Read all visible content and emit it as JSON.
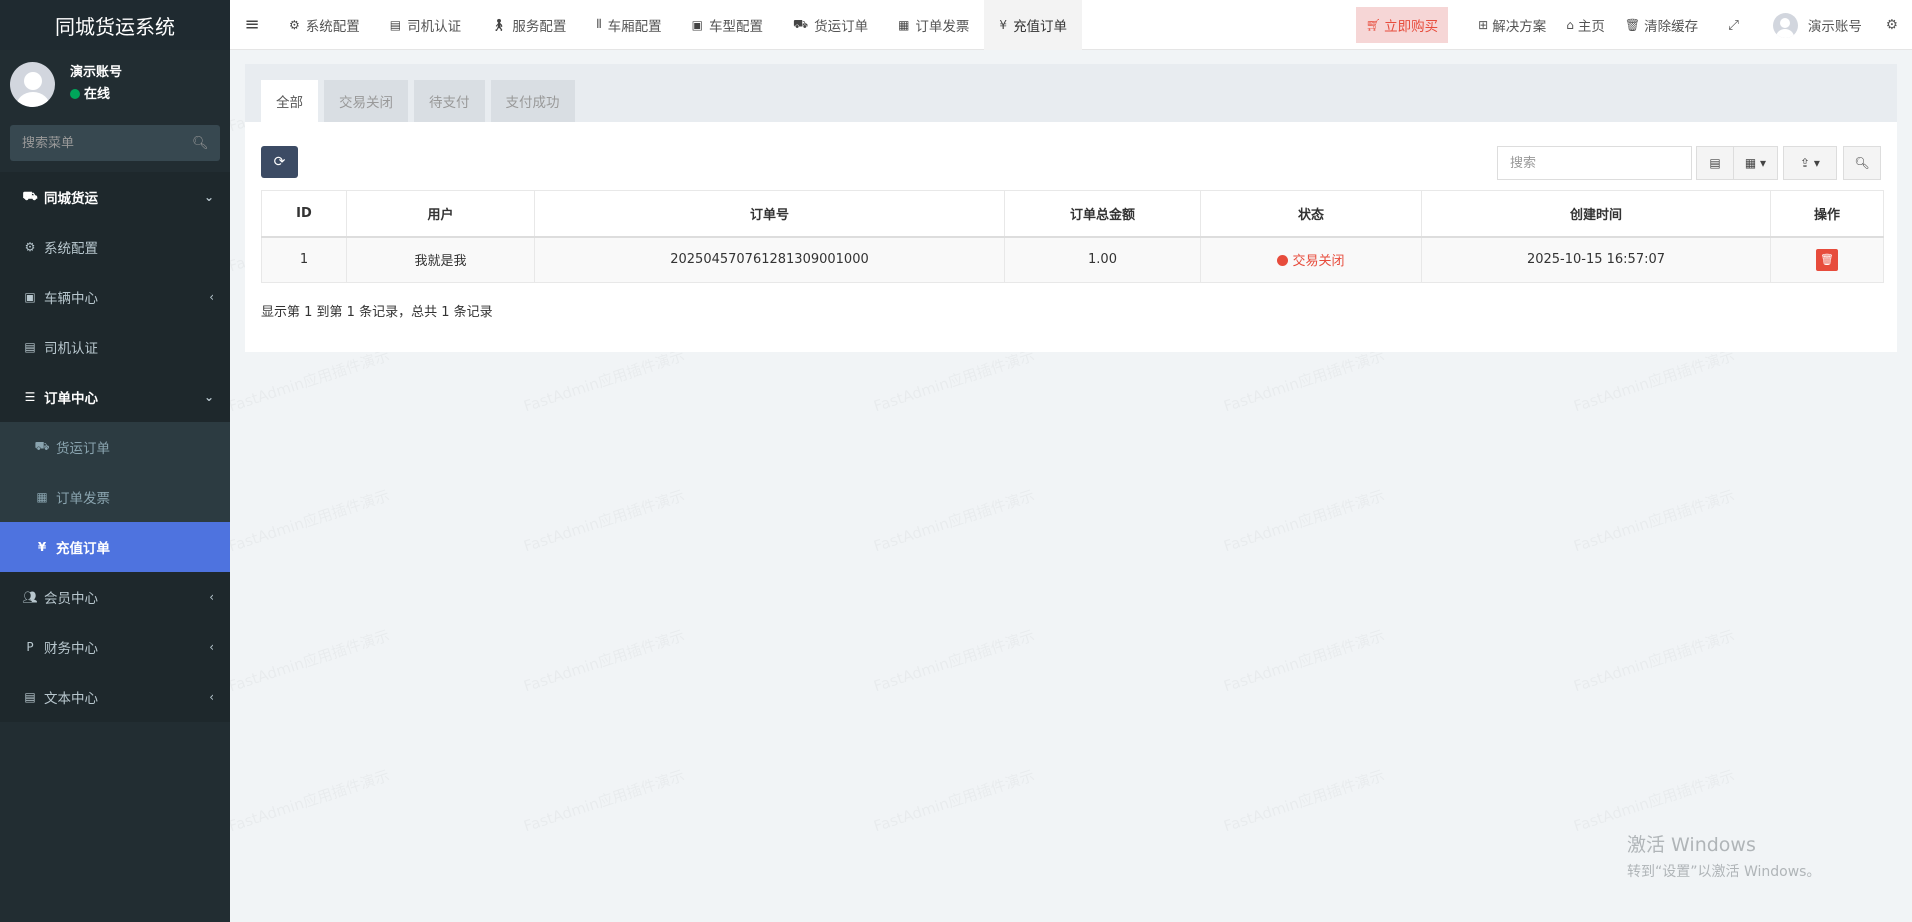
{
  "app": {
    "title": "同城货运系统"
  },
  "user": {
    "name": "演示账号",
    "status": "在线"
  },
  "sidebar": {
    "search_placeholder": "搜索菜单",
    "items": [
      {
        "label": "同城货运",
        "icon": "truck-icon"
      },
      {
        "label": "系统配置",
        "icon": "gear-icon"
      },
      {
        "label": "车辆中心",
        "icon": "bus-icon"
      },
      {
        "label": "司机认证",
        "icon": "id-card-icon"
      },
      {
        "label": "订单中心",
        "icon": "list-icon"
      },
      {
        "label": "货运订单",
        "icon": "truck-icon"
      },
      {
        "label": "订单发票",
        "icon": "archive-icon"
      },
      {
        "label": "充值订单",
        "icon": "yen-icon"
      },
      {
        "label": "会员中心",
        "icon": "users-icon"
      },
      {
        "label": "财务中心",
        "icon": "paypal-icon"
      },
      {
        "label": "文本中心",
        "icon": "file-icon"
      }
    ]
  },
  "topnav": {
    "tabs": [
      {
        "label": "系统配置"
      },
      {
        "label": "司机认证"
      },
      {
        "label": "服务配置"
      },
      {
        "label": "车厢配置"
      },
      {
        "label": "车型配置"
      },
      {
        "label": "货运订单"
      },
      {
        "label": "订单发票"
      },
      {
        "label": "充值订单"
      }
    ],
    "buy": "立即购买",
    "solutions": "解决方案",
    "home": "主页",
    "clear_cache": "清除缓存",
    "user": "演示账号"
  },
  "content": {
    "tabs": [
      "全部",
      "交易关闭",
      "待支付",
      "支付成功"
    ],
    "search_placeholder": "搜索",
    "table": {
      "headers": [
        "ID",
        "用户",
        "订单号",
        "订单总金额",
        "状态",
        "创建时间",
        "操作"
      ],
      "rows": [
        {
          "id": "1",
          "user": "我就是我",
          "order_no": "2025045707612813090​01000",
          "amount": "1.00",
          "status": "交易关闭",
          "created": "2025-10-15 16:57:07"
        }
      ]
    },
    "pagination": "显示第 1 到第 1 条记录，总共 1 条记录"
  },
  "watermark": "FastAdmin应用插件演示",
  "windows": {
    "line1": "激活 Windows",
    "line2": "转到“设置”以激活 Windows。"
  },
  "colors": {
    "sidebar_bg": "#222d32",
    "active": "#4e73df",
    "danger": "#e74c3c",
    "refresh": "#3c4b64"
  }
}
